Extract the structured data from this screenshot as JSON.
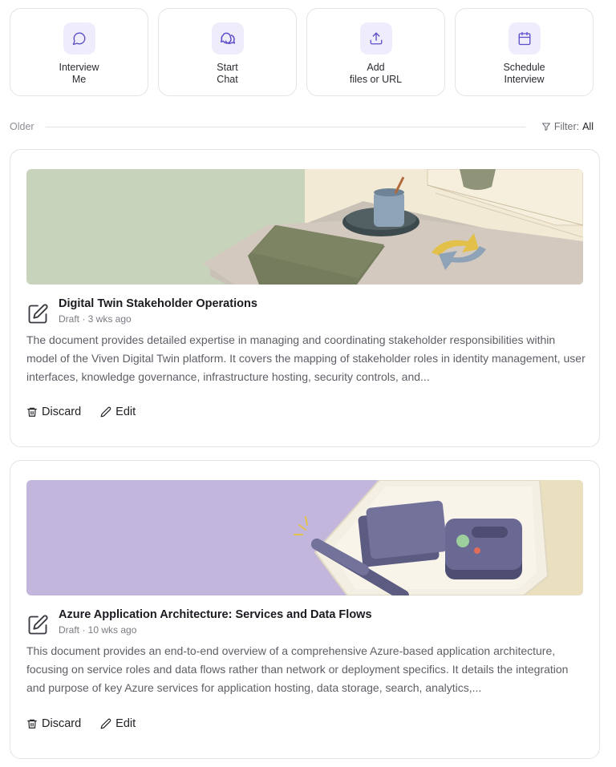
{
  "actions": [
    {
      "icon": "chat-bubble-icon",
      "line1": "Interview",
      "line2": "Me"
    },
    {
      "icon": "chat-bubbles-icon",
      "line1": "Start",
      "line2": "Chat"
    },
    {
      "icon": "upload-icon",
      "line1": "Add",
      "line2": "files or URL"
    },
    {
      "icon": "calendar-icon",
      "line1": "Schedule",
      "line2": "Interview"
    }
  ],
  "section": {
    "label": "Older"
  },
  "filter": {
    "label": "Filter:",
    "value": "All"
  },
  "cards": [
    {
      "title": "Digital Twin Stakeholder Operations",
      "meta": "Draft · 3 wks ago",
      "description": "The document provides detailed expertise in managing and coordinating stakeholder responsibilities within model of the Viven Digital Twin platform. It covers the mapping of stakeholder roles in identity management, user interfaces, knowledge governance, infrastructure hosting, security controls, and...",
      "discard_label": "Discard",
      "edit_label": "Edit"
    },
    {
      "title": "Azure Application Architecture: Services and Data Flows",
      "meta": "Draft · 10 wks ago",
      "description": "This document provides an end-to-end overview of a comprehensive Azure-based application architecture, focusing on service roles and data flows rather than network or deployment specifics. It details the integration and purpose of key Azure services for application hosting, data storage, search, analytics,...",
      "discard_label": "Discard",
      "edit_label": "Edit"
    }
  ],
  "colors": {
    "accent_tint": "#efecfb",
    "accent_icon": "#5b4fc9",
    "banner1_bg": "#c8d3bb",
    "banner2_bg": "#c2b6dd"
  }
}
